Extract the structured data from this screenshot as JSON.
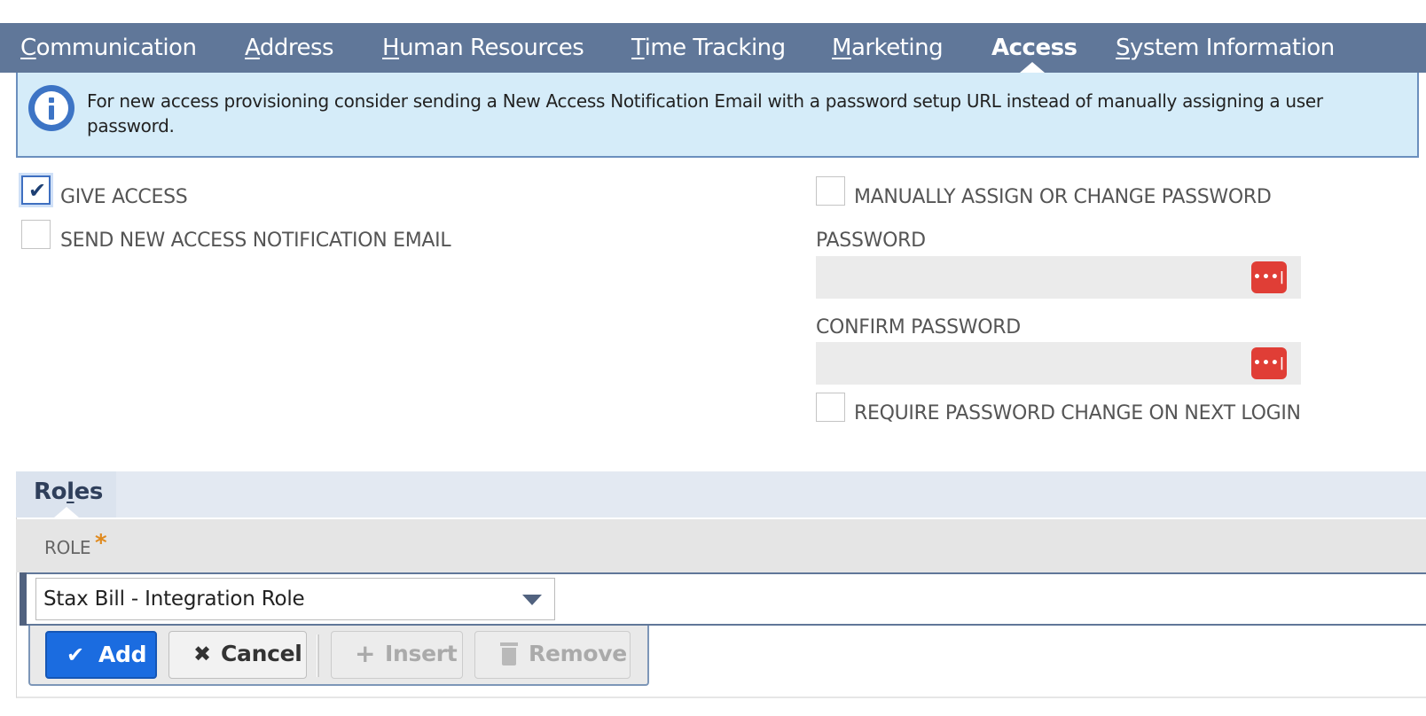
{
  "tabs": [
    {
      "first": "C",
      "rest": "ommunication"
    },
    {
      "first": "A",
      "rest": "ddress"
    },
    {
      "first": "H",
      "rest": "uman Resources"
    },
    {
      "first": "T",
      "rest": "ime Tracking"
    },
    {
      "first": "M",
      "rest": "arketing"
    },
    {
      "first": "Access",
      "rest": ""
    },
    {
      "first": "S",
      "rest": "ystem Information"
    }
  ],
  "active_tab": "Access",
  "info": {
    "icon": "info-icon",
    "text": "For new access provisioning consider sending a New Access Notification Email with a password setup URL instead of manually assigning a user password."
  },
  "access": {
    "give_access": {
      "label": "GIVE ACCESS",
      "checked": true
    },
    "send_email": {
      "label": "SEND NEW ACCESS NOTIFICATION EMAIL",
      "checked": false
    },
    "manual_password": {
      "label": "MANUALLY ASSIGN OR CHANGE PASSWORD",
      "checked": false
    },
    "password_label": "PASSWORD",
    "password_value": "",
    "confirm_label": "CONFIRM PASSWORD",
    "confirm_value": "",
    "password_button": "•••|",
    "require_change": {
      "label": "REQUIRE PASSWORD CHANGE ON NEXT LOGIN",
      "checked": false
    }
  },
  "roles": {
    "title_pre": "Ro",
    "title_u": "l",
    "title_post": "es",
    "column": "ROLE",
    "required": "*",
    "selected": "Stax Bill - Integration Role",
    "buttons": {
      "add": "Add",
      "cancel": "Cancel",
      "insert": "Insert",
      "remove": "Remove"
    }
  },
  "colors": {
    "tabbar": "#607799",
    "info_bg": "#d5ecf9",
    "add_button": "#1b6ce0",
    "password_button": "#e03e36"
  }
}
